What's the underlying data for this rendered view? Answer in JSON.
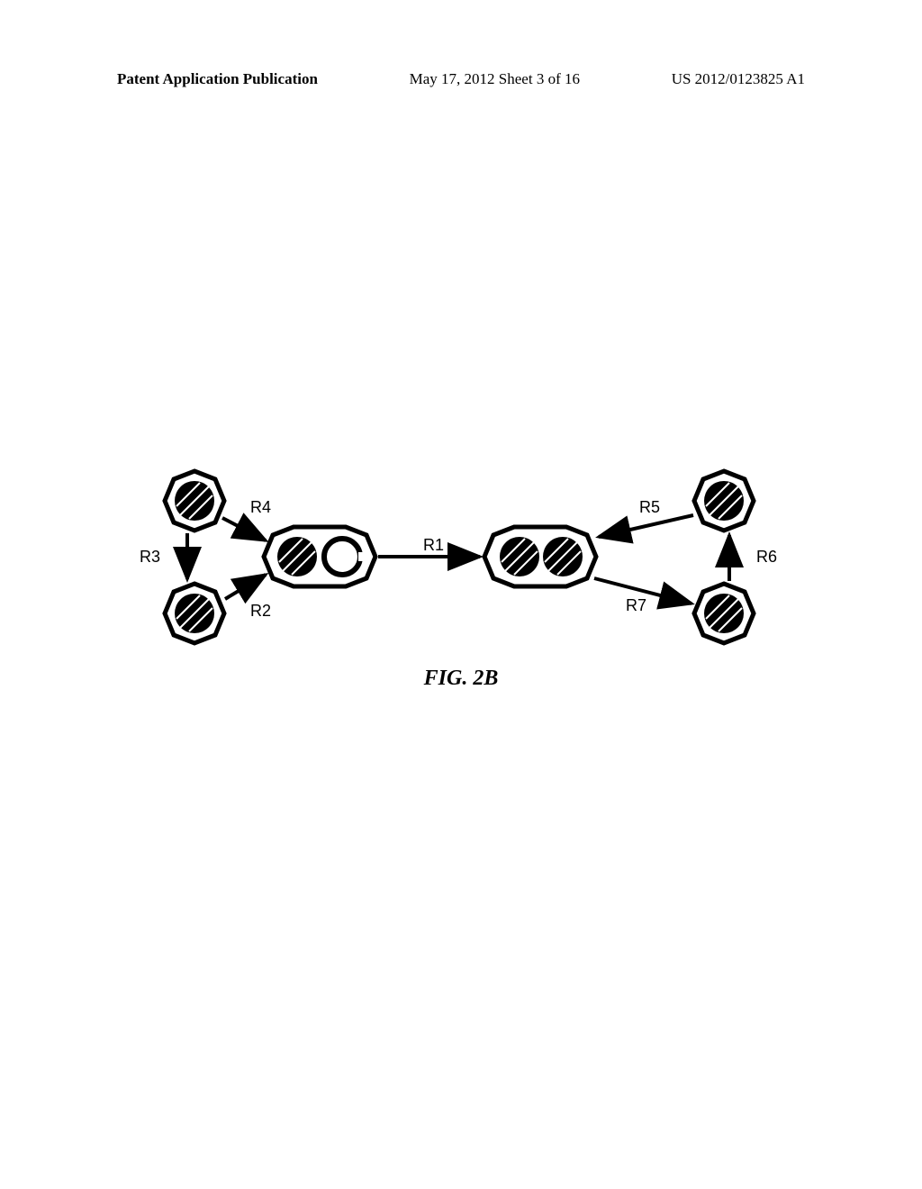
{
  "header": {
    "left": "Patent Application Publication",
    "center": "May 17, 2012  Sheet 3 of 16",
    "right": "US 2012/0123825 A1"
  },
  "figure": {
    "caption": "FIG. 2B",
    "labels": {
      "r1": "R1",
      "r2": "R2",
      "r3": "R3",
      "r4": "R4",
      "r5": "R5",
      "r6": "R6",
      "r7": "R7"
    }
  }
}
